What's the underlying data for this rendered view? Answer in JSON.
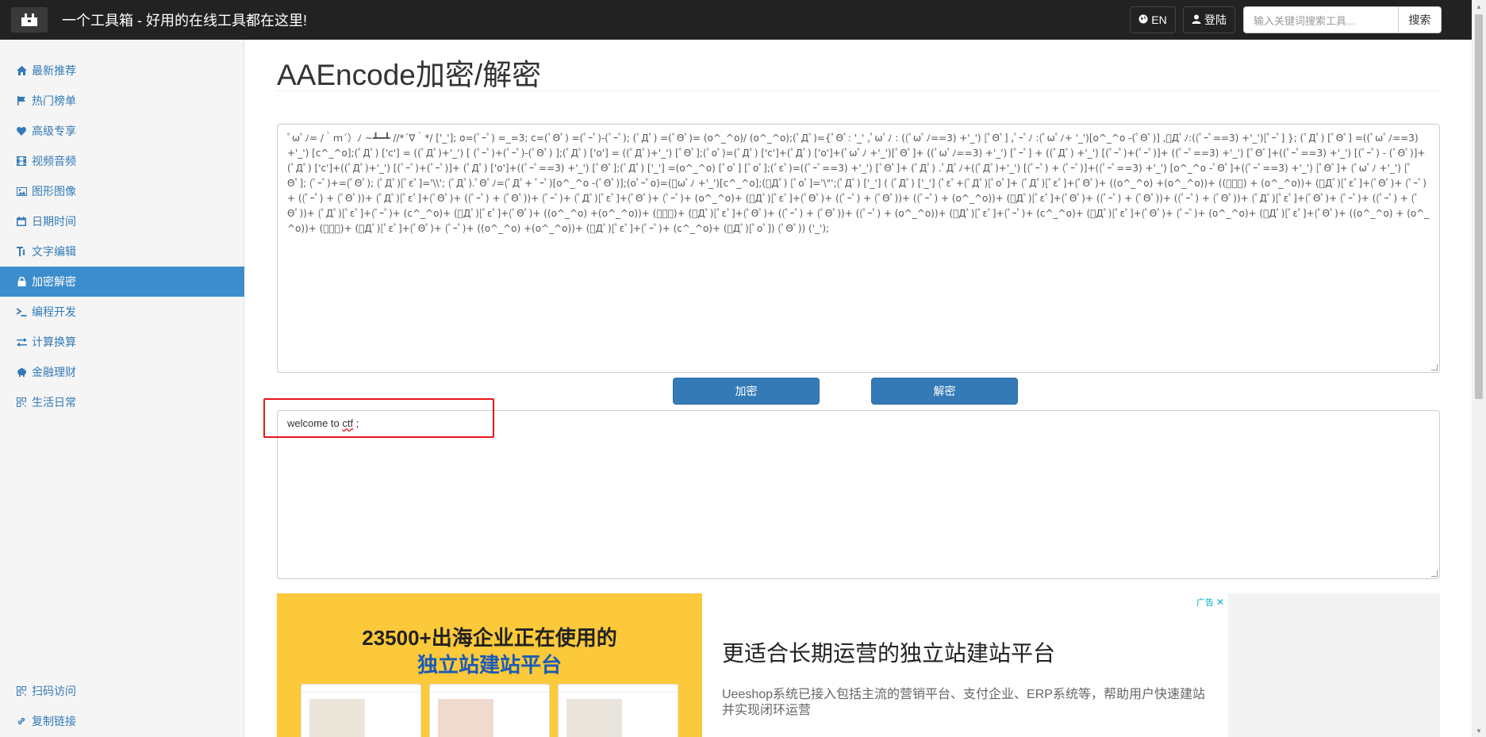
{
  "brand": {
    "title": "一个工具箱 - 好用的在线工具都在这里!"
  },
  "nav": {
    "lang_label": "EN",
    "login_label": "登陆",
    "search_placeholder": "输入关键词搜索工具...",
    "search_button": "搜索"
  },
  "sidebar": {
    "items": [
      {
        "label": "最新推荐",
        "icon": "home-icon"
      },
      {
        "label": "热门榜单",
        "icon": "flag-icon"
      },
      {
        "label": "高级专享",
        "icon": "heart-icon"
      },
      {
        "label": "视频音频",
        "icon": "film-icon"
      },
      {
        "label": "图形图像",
        "icon": "picture-icon"
      },
      {
        "label": "日期时间",
        "icon": "calendar-icon"
      },
      {
        "label": "文字编辑",
        "icon": "text-height-icon"
      },
      {
        "label": "加密解密",
        "icon": "lock-icon"
      },
      {
        "label": "编程开发",
        "icon": "terminal-icon"
      },
      {
        "label": "计算换算",
        "icon": "transfer-icon"
      },
      {
        "label": "金融理财",
        "icon": "piggy-bank-icon"
      },
      {
        "label": "生活日常",
        "icon": "qrcode-icon"
      }
    ],
    "bottom_items": [
      {
        "label": "扫码访问",
        "icon": "qrcode-icon"
      },
      {
        "label": "复制链接",
        "icon": "link-icon"
      }
    ]
  },
  "main": {
    "title": "AAEncode加密/解密",
    "input_text": "ﾟωﾟﾉ= /｀ｍ´）ﾉ ~┻━┻ //*´∇｀*/ ['_']; o=(ﾟｰﾟ) =_=3; c=(ﾟΘﾟ) =(ﾟｰﾟ)-(ﾟｰﾟ); (ﾟДﾟ) =(ﾟΘﾟ)= (o^_^o)/ (o^_^o);(ﾟДﾟ)={ﾟΘﾟ: '_' ,ﾟωﾟﾉ : ((ﾟωﾟﾉ==3) +'_') [ﾟΘﾟ] ,ﾟｰﾟﾉ :(ﾟωﾟﾉ+ '_')[o^_^o -(ﾟΘﾟ)] ,ﾟДﾟﾉ:((ﾟｰﾟ==3) +'_')[ﾟｰﾟ] }; (ﾟДﾟ) [ﾟΘﾟ] =((ﾟωﾟﾉ==3) +'_') [c^_^o];(ﾟДﾟ) ['c'] = ((ﾟДﾟ)+'_') [ (ﾟｰﾟ)+(ﾟｰﾟ)-(ﾟΘﾟ) ];(ﾟДﾟ) ['o'] = ((ﾟДﾟ)+'_') [ﾟΘﾟ];(ﾟoﾟ)=(ﾟДﾟ) ['c']+(ﾟДﾟ) ['o']+(ﾟωﾟﾉ +'_')[ﾟΘﾟ]+ ((ﾟωﾟﾉ==3) +'_') [ﾟｰﾟ] + ((ﾟДﾟ) +'_') [(ﾟｰﾟ)+(ﾟｰﾟ)]+ ((ﾟｰﾟ==3) +'_') [ﾟΘﾟ]+((ﾟｰﾟ==3) +'_') [(ﾟｰﾟ) - (ﾟΘﾟ)]+(ﾟДﾟ) ['c']+((ﾟДﾟ)+'_') [(ﾟｰﾟ)+(ﾟｰﾟ)]+ (ﾟДﾟ) ['o']+((ﾟｰﾟ==3) +'_') [ﾟΘﾟ];(ﾟДﾟ) ['_'] =(o^_^o) [ﾟoﾟ] [ﾟoﾟ];(ﾟεﾟ)=((ﾟｰﾟ==3) +'_') [ﾟΘﾟ]+ (ﾟДﾟ) .ﾟДﾟﾉ+((ﾟДﾟ)+'_') [(ﾟｰﾟ) + (ﾟｰﾟ)]+((ﾟｰﾟ==3) +'_') [o^_^o -ﾟΘﾟ]+((ﾟｰﾟ==3) +'_') [ﾟΘﾟ]+ (ﾟωﾟﾉ +'_') [ﾟΘﾟ]; (ﾟｰﾟ)+=(ﾟΘﾟ); (ﾟДﾟ)[ﾟεﾟ]='\\\\'; (ﾟДﾟ).ﾟΘﾟﾉ=(ﾟДﾟ+ ﾟｰﾟ)[o^_^o -(ﾟΘﾟ)];(oﾟｰﾟo)=(ﾟωﾟﾉ +'_')[c^_^o];(ﾟДﾟ) [ﾟoﾟ]='\\\"';(ﾟДﾟ) ['_'] ( (ﾟДﾟ) ['_'] (ﾟεﾟ+(ﾟДﾟ)[ﾟoﾟ]+ (ﾟДﾟ)[ﾟεﾟ]+(ﾟΘﾟ)+ ((o^_^o) +(o^_^o))+ ((ﾟｰﾟ) + (o^_^o))+ (ﾟДﾟ)[ﾟεﾟ]+(ﾟΘﾟ)+ (ﾟｰﾟ)+ ((ﾟｰﾟ) + (ﾟΘﾟ))+ (ﾟДﾟ)[ﾟεﾟ]+(ﾟΘﾟ)+ ((ﾟｰﾟ) + (ﾟΘﾟ))+ (ﾟｰﾟ)+ (ﾟДﾟ)[ﾟεﾟ]+(ﾟΘﾟ)+ (ﾟｰﾟ)+ (o^_^o)+ (ﾟДﾟ)[ﾟεﾟ]+(ﾟΘﾟ)+ ((ﾟｰﾟ) + (ﾟΘﾟ))+ ((ﾟｰﾟ) + (o^_^o))+ (ﾟДﾟ)[ﾟεﾟ]+(ﾟΘﾟ)+ ((ﾟｰﾟ) + (ﾟΘﾟ))+ ((ﾟｰﾟ) + (ﾟΘﾟ))+ (ﾟДﾟ)[ﾟεﾟ]+(ﾟΘﾟ)+ (ﾟｰﾟ)+ ((ﾟｰﾟ) + (ﾟΘﾟ))+ (ﾟДﾟ)[ﾟεﾟ]+(ﾟｰﾟ)+ (c^_^o)+ (ﾟДﾟ)[ﾟεﾟ]+(ﾟΘﾟ)+ ((o^_^o) +(o^_^o))+ (ﾟｰﾟ)+ (ﾟДﾟ)[ﾟεﾟ]+(ﾟΘﾟ)+ ((ﾟｰﾟ) + (ﾟΘﾟ))+ ((ﾟｰﾟ) + (o^_^o))+ (ﾟДﾟ)[ﾟεﾟ]+(ﾟｰﾟ)+ (c^_^o)+ (ﾟДﾟ)[ﾟεﾟ]+(ﾟΘﾟ)+ (ﾟｰﾟ)+ (o^_^o)+ (ﾟДﾟ)[ﾟεﾟ]+(ﾟΘﾟ)+ ((o^_^o) + (o^_^o))+ (ﾟｰﾟ)+ (ﾟДﾟ)[ﾟεﾟ]+(ﾟΘﾟ)+ (ﾟｰﾟ)+ ((o^_^o) +(o^_^o))+ (ﾟДﾟ)[ﾟεﾟ]+(ﾟｰﾟ)+ (c^_^o)+ (ﾟДﾟ)[ﾟoﾟ]) (ﾟΘﾟ)) ('_');",
    "encrypt_button": "加密",
    "decrypt_button": "解密",
    "output_prefix": "welcome to ",
    "output_word": "ctf",
    "output_suffix": " ;"
  },
  "ad": {
    "marker": "广告",
    "left_headline": "23500+出海企业正在使用的",
    "left_sub": "独立站建站平台",
    "right_title": "更适合长期运营的独立站建站平台",
    "right_desc": "Ueeshop系统已接入包括主流的营销平台、支付企业、ERP系统等，帮助用户快速建站并实现闭环运营"
  }
}
